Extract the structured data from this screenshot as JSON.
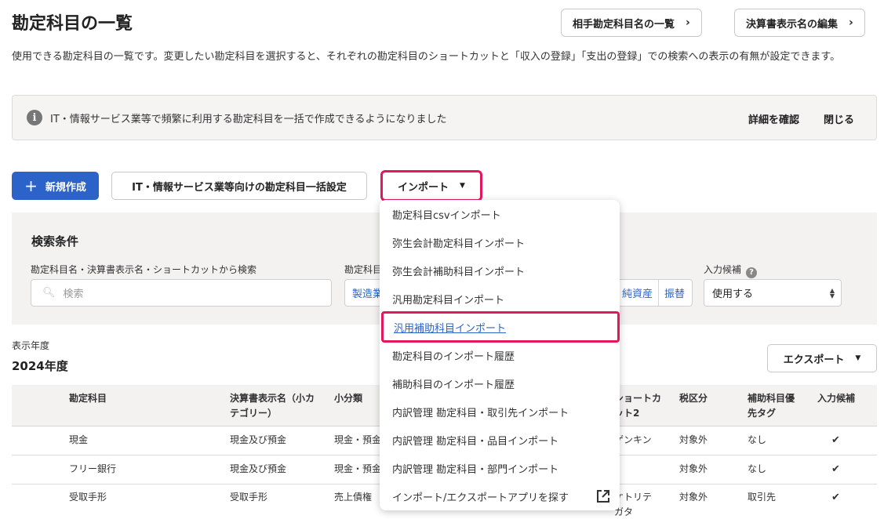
{
  "header": {
    "title": "勘定科目の一覧",
    "partner_button": "相手勘定科目名の一覧",
    "display_name_button": "決算書表示名の編集",
    "description": "使用できる勘定科目の一覧です。変更したい勘定科目を選択すると、それぞれの勘定科目のショートカットと「収入の登録」「支出の登録」での検索への表示の有無が設定できます。"
  },
  "notice": {
    "text": "IT・情報サービス業等で頻繁に利用する勘定科目を一括で作成できるようになりました",
    "detail_link": "詳細を確認",
    "close_link": "閉じる"
  },
  "toolbar": {
    "new_button": "新規作成",
    "bulk_button": "IT・情報サービス業等向けの勘定科目一括設定",
    "import_button": "インポート"
  },
  "search": {
    "title": "検索条件",
    "keyword_label": "勘定科目名・決算書表示名・ショートカットから検索",
    "keyword_placeholder": "検索",
    "category_label": "勘定科目",
    "category_first": "製造業",
    "category_seg1": "純資産",
    "category_seg2": "振替",
    "candidate_label": "入力候補",
    "candidate_value": "使用する"
  },
  "year": {
    "label": "表示年度",
    "value": "2024年度"
  },
  "export_button": "エクスポート",
  "table": {
    "headers": {
      "account": "勘定科目",
      "display_name_1": "決算書表示名（小カ",
      "display_name_2": "テゴリー）",
      "subcategory": "小分類",
      "shortcut_1": "ショートカ",
      "shortcut_2": "ット2",
      "tax": "税区分",
      "sub_priority_1": "補助科目優",
      "sub_priority_2": "先タグ",
      "candidate": "入力候補"
    },
    "rows": [
      {
        "account": "現金",
        "display_name": "現金及び預金",
        "subcategory": "現金・預金",
        "shortcut": "ゲンキン",
        "shortcut_2": "",
        "tax": "対象外",
        "sub_priority": "なし",
        "candidate": "✔"
      },
      {
        "account": "フリー銀行",
        "display_name": "現金及び預金",
        "subcategory": "現金・預金",
        "shortcut": "",
        "shortcut_2": "",
        "tax": "対象外",
        "sub_priority": "なし",
        "candidate": "✔"
      },
      {
        "account": "受取手形",
        "display_name": "受取手形",
        "subcategory": "売上債権",
        "shortcut": "ケトリテ",
        "shortcut_2": "ガタ",
        "tax": "対象外",
        "sub_priority": "取引先",
        "candidate": "✔"
      }
    ]
  },
  "dropdown": {
    "items": [
      "勘定科目csvインポート",
      "弥生会計勘定科目インポート",
      "弥生会計補助科目インポート",
      "汎用勘定科目インポート",
      "汎用補助科目インポート",
      "勘定科目のインポート履歴",
      "補助科目のインポート履歴",
      "内訳管理 勘定科目・取引先インポート",
      "内訳管理 勘定科目・品目インポート",
      "内訳管理 勘定科目・部門インポート",
      "インポート/エクスポートアプリを探す"
    ],
    "highlighted": "汎用補助科目インポート"
  },
  "colors": {
    "primary": "#2c63c9",
    "highlight": "#e2175c",
    "panel": "#f3f2f1"
  }
}
